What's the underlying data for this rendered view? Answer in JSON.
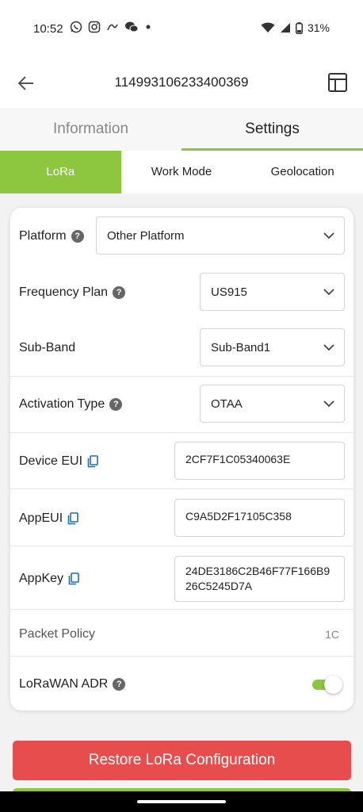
{
  "status_bar": {
    "time": "10:52",
    "notification_icons": [
      "whatsapp-icon",
      "instagram-icon",
      "pinned-link-icon",
      "wechat-icon",
      "dot-icon"
    ],
    "battery": "31%"
  },
  "app_bar": {
    "title": "114993106233400369",
    "back_icon": "arrow-left-icon",
    "action_icon": "layout-icon"
  },
  "main_tabs": [
    {
      "label": "Information",
      "active": false
    },
    {
      "label": "Settings",
      "active": true
    }
  ],
  "sub_tabs": [
    {
      "label": "LoRa",
      "active": true
    },
    {
      "label": "Work Mode",
      "active": false
    },
    {
      "label": "Geolocation",
      "active": false
    }
  ],
  "settings": {
    "platform": {
      "label": "Platform",
      "value": "Other Platform"
    },
    "frequency_plan": {
      "label": "Frequency Plan",
      "value": "US915"
    },
    "sub_band": {
      "label": "Sub-Band",
      "value": "Sub-Band1"
    },
    "activation_type": {
      "label": "Activation Type",
      "value": "OTAA"
    },
    "device_eui": {
      "label": "Device EUI",
      "value": "2CF7F1C05340063E"
    },
    "app_eui": {
      "label": "AppEUI",
      "value": "C9A5D2F17105C358"
    },
    "app_key": {
      "label": "AppKey",
      "value": "24DE3186C2B46F77F166B926C5245D7A"
    },
    "packet_policy": {
      "label": "Packet Policy",
      "value": "1C"
    },
    "lorawan_adr": {
      "label": "LoRaWAN ADR",
      "enabled": true
    }
  },
  "buttons": {
    "restore": "Restore LoRa Configuration"
  },
  "colors": {
    "accent_green": "#8cc63f",
    "danger_red": "#e84d4e"
  }
}
